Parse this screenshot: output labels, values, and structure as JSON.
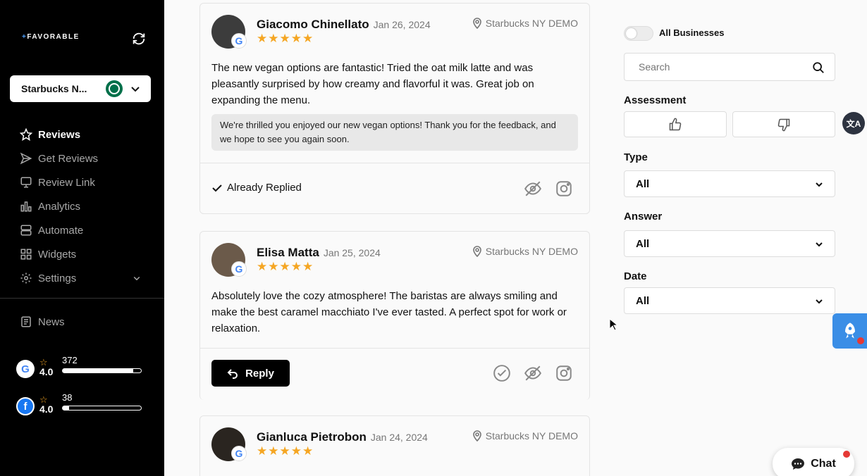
{
  "sidebar": {
    "logo": "FAVORABLE",
    "business_select": "Starbucks N...",
    "nav": [
      {
        "label": "Reviews",
        "icon": "star-icon",
        "active": true
      },
      {
        "label": "Get Reviews",
        "icon": "send-icon"
      },
      {
        "label": "Review Link",
        "icon": "monitor-icon"
      },
      {
        "label": "Analytics",
        "icon": "bar-chart-icon"
      },
      {
        "label": "Automate",
        "icon": "automate-icon"
      },
      {
        "label": "Widgets",
        "icon": "widgets-icon"
      },
      {
        "label": "Settings",
        "icon": "gear-icon"
      }
    ],
    "news": "News",
    "platforms": [
      {
        "name": "google",
        "rating": "4.0",
        "count": "372",
        "fill": 0.9
      },
      {
        "name": "facebook",
        "rating": "4.0",
        "count": "38",
        "fill": 0.08
      }
    ]
  },
  "reviews": [
    {
      "name": "Giacomo Chinellato",
      "date": "Jan 26, 2024",
      "location": "Starbucks NY DEMO",
      "stars": "★★★★★",
      "text": "The new vegan options are fantastic! Tried the oat milk latte and was pleasantly surprised by how creamy and flavorful it was. Great job on expanding the menu.",
      "reply": "We're thrilled you enjoyed our new vegan options! Thank you for the feedback, and we hope to see you again soon.",
      "status": "Already Replied"
    },
    {
      "name": "Elisa Matta",
      "date": "Jan 25, 2024",
      "location": "Starbucks NY DEMO",
      "stars": "★★★★★",
      "text": "Absolutely love the cozy atmosphere! The baristas are always smiling and make the best caramel macchiato I've ever tasted. A perfect spot for work or relaxation.",
      "reply_button": "Reply"
    },
    {
      "name": "Gianluca Pietrobon",
      "date": "Jan 24, 2024",
      "location": "Starbucks NY DEMO",
      "stars": "★★★★★"
    }
  ],
  "filters": {
    "all_businesses": "All Businesses",
    "search_placeholder": "Search",
    "assessment_label": "Assessment",
    "type_label": "Type",
    "type_value": "All",
    "answer_label": "Answer",
    "answer_value": "All",
    "date_label": "Date",
    "date_value": "All"
  },
  "widgets": {
    "chat": "Chat",
    "translate": "文A"
  },
  "colors": {
    "star": "#f5a623",
    "sidebar_bg": "#000000",
    "rocket_bg": "#3a8ee6"
  }
}
